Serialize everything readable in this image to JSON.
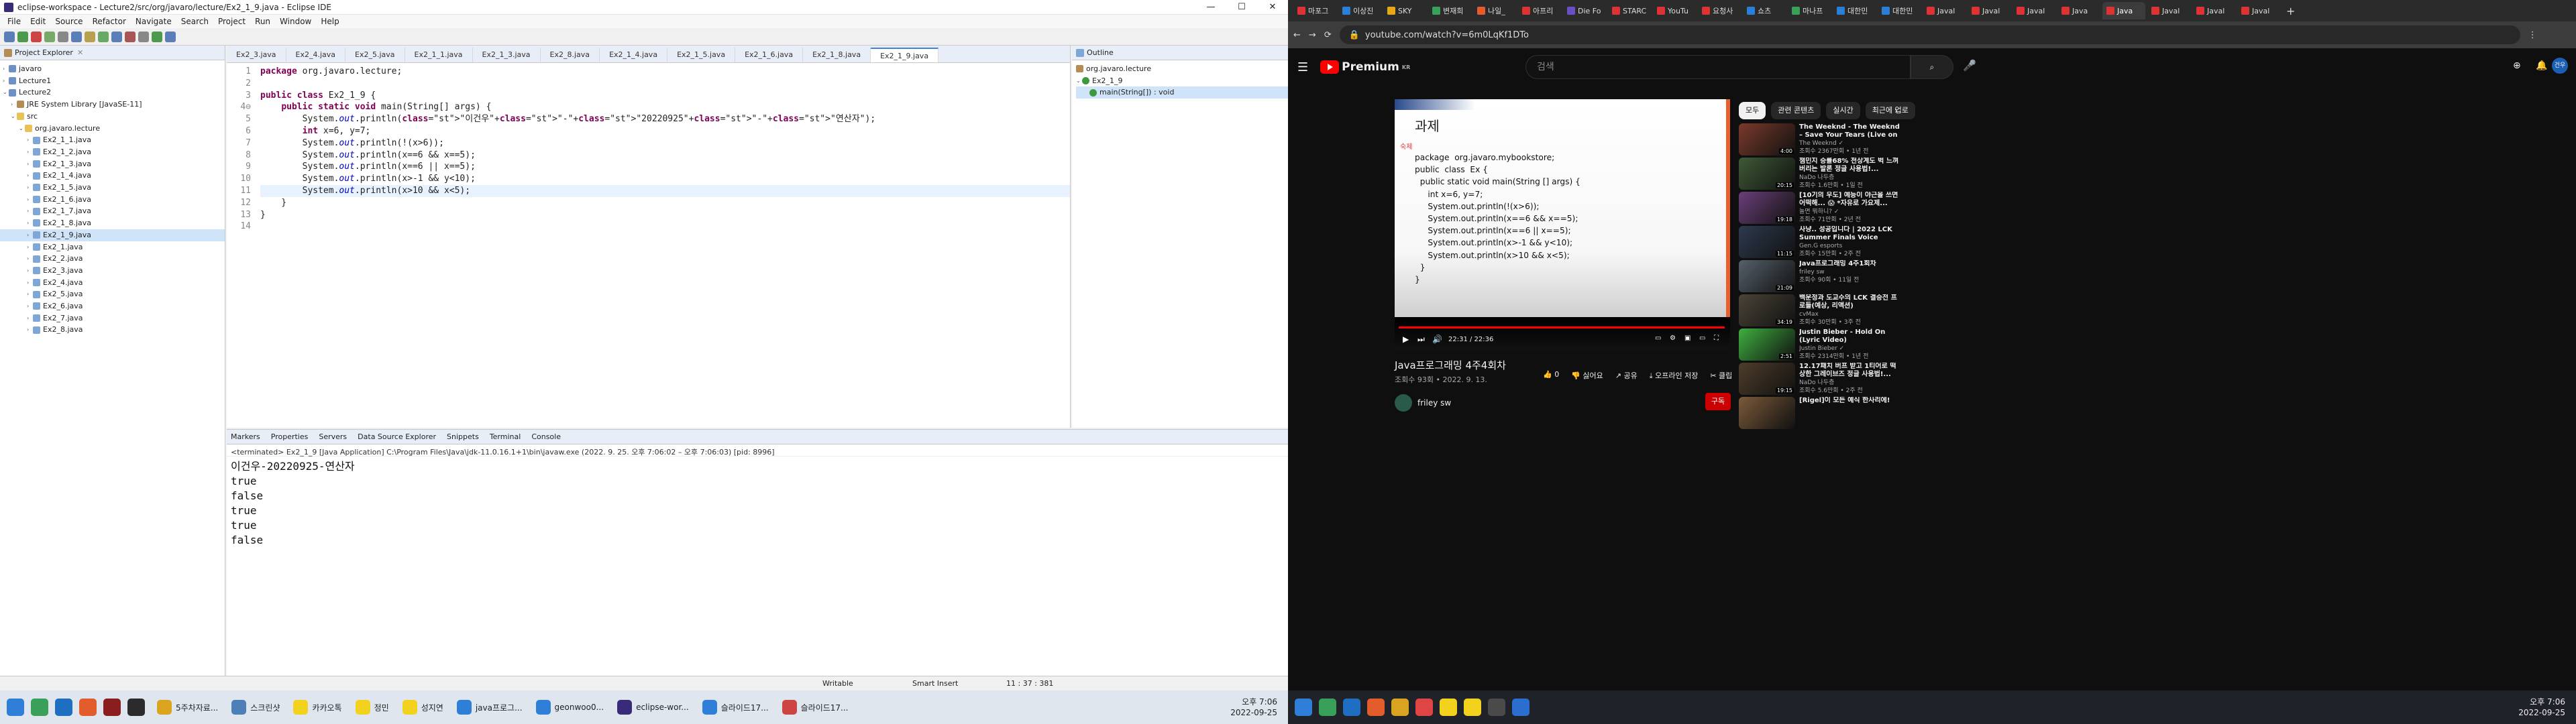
{
  "eclipse": {
    "window_title": "eclipse-workspace - Lecture2/src/org/javaro/lecture/Ex2_1_9.java - Eclipse IDE",
    "window_controls": [
      "—",
      "☐",
      "✕"
    ],
    "menu": [
      "File",
      "Edit",
      "Source",
      "Refactor",
      "Navigate",
      "Search",
      "Project",
      "Run",
      "Window",
      "Help"
    ],
    "project_explorer": {
      "title": "Project Explorer",
      "items": [
        {
          "label": "javaro",
          "depth": 0,
          "kind": "project",
          "twisty": "›"
        },
        {
          "label": "Lecture1",
          "depth": 0,
          "kind": "project",
          "twisty": "›"
        },
        {
          "label": "Lecture2",
          "depth": 0,
          "kind": "project",
          "twisty": "⌄"
        },
        {
          "label": "JRE System Library [JavaSE-11]",
          "depth": 1,
          "kind": "lib",
          "twisty": "›"
        },
        {
          "label": "src",
          "depth": 1,
          "kind": "folder",
          "twisty": "⌄"
        },
        {
          "label": "org.javaro.lecture",
          "depth": 2,
          "kind": "folder",
          "twisty": "⌄"
        },
        {
          "label": "Ex2_1_1.java",
          "depth": 3,
          "kind": "java",
          "twisty": "›"
        },
        {
          "label": "Ex2_1_2.java",
          "depth": 3,
          "kind": "java",
          "twisty": "›"
        },
        {
          "label": "Ex2_1_3.java",
          "depth": 3,
          "kind": "java",
          "twisty": "›"
        },
        {
          "label": "Ex2_1_4.java",
          "depth": 3,
          "kind": "java",
          "twisty": "›"
        },
        {
          "label": "Ex2_1_5.java",
          "depth": 3,
          "kind": "java",
          "twisty": "›"
        },
        {
          "label": "Ex2_1_6.java",
          "depth": 3,
          "kind": "java",
          "twisty": "›"
        },
        {
          "label": "Ex2_1_7.java",
          "depth": 3,
          "kind": "java",
          "twisty": "›"
        },
        {
          "label": "Ex2_1_8.java",
          "depth": 3,
          "kind": "java",
          "twisty": "›"
        },
        {
          "label": "Ex2_1_9.java",
          "depth": 3,
          "kind": "java",
          "twisty": "›",
          "selected": true
        },
        {
          "label": "Ex2_1.java",
          "depth": 3,
          "kind": "java",
          "twisty": "›"
        },
        {
          "label": "Ex2_2.java",
          "depth": 3,
          "kind": "java",
          "twisty": "›"
        },
        {
          "label": "Ex2_3.java",
          "depth": 3,
          "kind": "java",
          "twisty": "›"
        },
        {
          "label": "Ex2_4.java",
          "depth": 3,
          "kind": "java",
          "twisty": "›"
        },
        {
          "label": "Ex2_5.java",
          "depth": 3,
          "kind": "java",
          "twisty": "›"
        },
        {
          "label": "Ex2_6.java",
          "depth": 3,
          "kind": "java",
          "twisty": "›"
        },
        {
          "label": "Ex2_7.java",
          "depth": 3,
          "kind": "java",
          "twisty": "›"
        },
        {
          "label": "Ex2_8.java",
          "depth": 3,
          "kind": "java",
          "twisty": "›"
        }
      ]
    },
    "editor_tabs": [
      "Ex2_3.java",
      "Ex2_4.java",
      "Ex2_5.java",
      "Ex2_1_1.java",
      "Ex2_1_3.java",
      "Ex2_8.java",
      "Ex2_1_4.java",
      "Ex2_1_5.java",
      "Ex2_1_6.java",
      "Ex2_1_8.java",
      "Ex2_1_9.java"
    ],
    "active_tab": "Ex2_1_9.java",
    "code": [
      "package org.javaro.lecture;",
      "",
      "public class Ex2_1_9 {",
      "    public static void main(String[] args) {",
      "        System.out.println(\"이건우\"+\"-\"+\"20220925\"+\"-\"+\"연산자\");",
      "        int x=6, y=7;",
      "        System.out.println(!(x>6));",
      "        System.out.println(x==6 && x==5);",
      "        System.out.println(x==6 || x==5);",
      "        System.out.println(x>-1 && y<10);",
      "        System.out.println(x>10 && x<5);",
      "    }",
      "}",
      ""
    ],
    "line_numbers": [
      "1",
      "2",
      "3",
      "4⊖",
      "5",
      "6",
      "7",
      "8",
      "9",
      "10",
      "11",
      "12",
      "13",
      "14"
    ],
    "outline": {
      "title": "Outline",
      "items": [
        "org.javaro.lecture",
        "Ex2_1_9",
        "main(String[]) : void"
      ]
    },
    "console_tabs": [
      "Markers",
      "Properties",
      "Servers",
      "Data Source Explorer",
      "Snippets",
      "Terminal",
      "Console"
    ],
    "console_header": "<terminated> Ex2_1_9 [Java Application] C:\\Program Files\\Java\\jdk-11.0.16.1+1\\bin\\javaw.exe  (2022. 9. 25. 오후 7:06:02 – 오후 7:06:03) [pid: 8996]",
    "console_output": [
      "이건우-20220925-연산자",
      "true",
      "false",
      "true",
      "true",
      "false"
    ],
    "status": {
      "mode": "Writable",
      "insert": "Smart Insert",
      "pos": "11 : 37 : 381"
    }
  },
  "taskbar_left": {
    "windows": [
      "5주차자료...",
      "스크린샷",
      "카카오톡",
      "정민",
      "성지연",
      "java프로그...",
      "geonwoo0...",
      "eclipse-wor...",
      "슬라이드17...",
      "슬라이드17..."
    ],
    "time": "오후 7:06",
    "date": "2022-09-25",
    "tray": "^ 🔊 가"
  },
  "chrome": {
    "tabs": [
      "마포그",
      "이상진",
      "SKY",
      "변재희",
      "나일_",
      "아프리",
      "Die Fo",
      "STARC",
      "YouTu",
      "요청사",
      "쇼츠",
      "마나프",
      "대한민",
      "대한민",
      "Javal",
      "Javal",
      "Javal",
      "Java",
      "Java",
      "Javal",
      "Javal",
      "Javal"
    ],
    "active_tab_index": 18,
    "url": "youtube.com/watch?v=6m0LqKf1DTo",
    "new_tab": "+"
  },
  "youtube": {
    "search_placeholder": "검색",
    "logo_text": "Premium",
    "logo_sup": "KR",
    "avatar_text": "건우",
    "slide_title": "과제",
    "slide_homework": "숙제",
    "slide_code": "package  org.javaro.mybookstore;\npublic  class  Ex {\n  public static void main(String [] args) {\n     int x=6, y=7;\n     System.out.println(!(x>6));\n     System.out.println(x==6 && x==5);\n     System.out.println(x==6 || x==5);\n     System.out.println(x>-1 && y<10);\n     System.out.println(x>10 && x<5);\n  }\n}",
    "time_display": "22:31 / 22:36",
    "progress": 0.996,
    "video_title": "Java프로그래밍 4주4회차",
    "video_meta": "조회수 93회 • 2022. 9. 13.",
    "actions": [
      "👍 0",
      "👎 싫어요",
      "↗ 공유",
      "⤓ 오프라인 저장",
      "✂ 클립",
      "≡+ 저장",
      "···"
    ],
    "channel": "friley sw",
    "subscribe": "구독",
    "chips": [
      "모두",
      "관련 콘텐츠",
      "실시간",
      "최근에 업로"
    ],
    "recs": [
      {
        "title": "The Weeknd - The Weeknd – Save Your Tears (Live on The...",
        "channel": "The Weeknd ✓",
        "meta": "조회수 2367만회 • 1년 전",
        "dur": "4:00",
        "color": "#7a3a2a"
      },
      {
        "title": "챔민지 승률68% 천상계도 벅 느껴버리는 발론 정글 사용법!...",
        "channel": "NaDo 나두층",
        "meta": "조회수 1.6만회 • 1일 전",
        "dur": "20:15",
        "color": "#3f5a36"
      },
      {
        "title": "[10기의 우도] 예능이 야근을 쓰면 어떡해... 😱 *자유로 가요제...",
        "channel": "놀면 뭐하니? ✓",
        "meta": "조회수 71만회 • 2년 전",
        "dur": "19:18",
        "color": "#6a3f78"
      },
      {
        "title": "사냥.. 성공입니다 | 2022 LCK Summer Finals Voice Comms...",
        "channel": "Gen.G esports",
        "meta": "조회수 15만회 • 2주 전",
        "dur": "11:15",
        "color": "#2d3a4f"
      },
      {
        "title": "Java프로그래밍 4주1회차",
        "channel": "friley sw",
        "meta": "조회수 90회 • 11일 전",
        "dur": "21:09",
        "color": "#55606a"
      },
      {
        "title": "백운정과 도교수의 LCK 결승전 프로들(예상, 리액션)",
        "channel": "cvMax",
        "meta": "조회수 30만회 • 3주 전",
        "dur": "34:19",
        "color": "#4a4438"
      },
      {
        "title": "Justin Bieber - Hold On (Lyric Video)",
        "channel": "Justin Bieber ✓",
        "meta": "조회수 2314만회 • 1년 전",
        "dur": "2:51",
        "color": "#3fae3f"
      },
      {
        "title": "12.17패치 버프 받고 1티어로 떡상한 그레이브즈 정글 사용법!...",
        "channel": "NaDo 나두층",
        "meta": "조회수 5.6만회 • 2주 전",
        "dur": "19:15",
        "color": "#4d3d2a"
      },
      {
        "title": "[Rigel]이 모든 예식 한사리에!",
        "channel": "",
        "meta": "",
        "dur": "",
        "color": "#7b5a3a"
      }
    ]
  },
  "taskbar_right": {
    "time": "오후 7:06",
    "date": "2022-09-25"
  }
}
